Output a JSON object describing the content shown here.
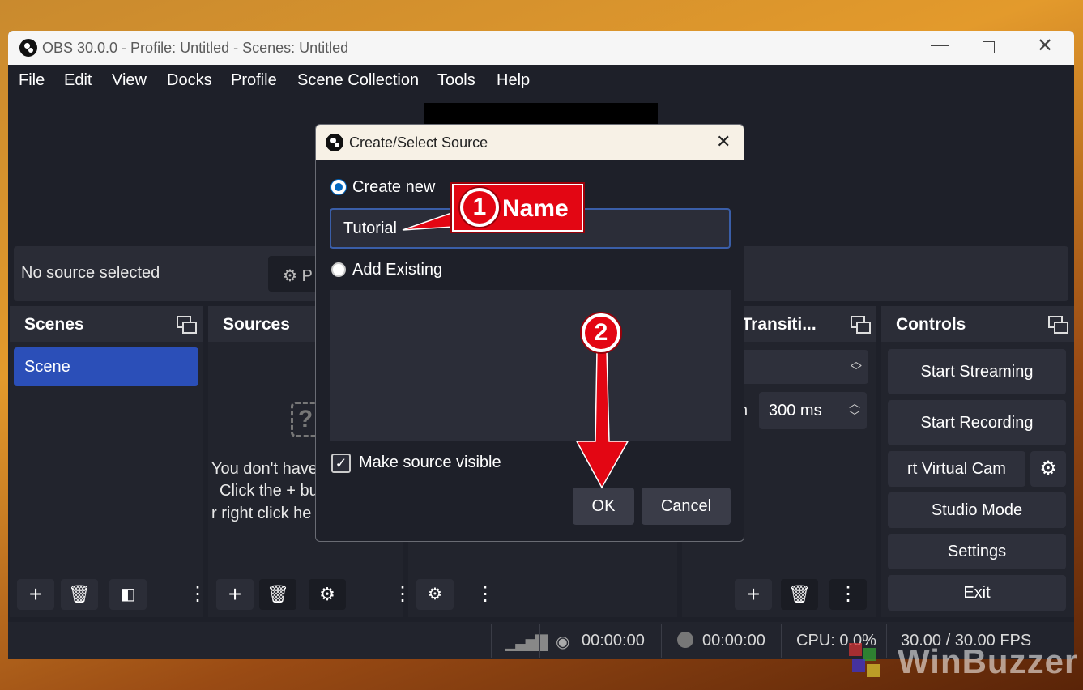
{
  "window": {
    "title": "OBS 30.0.0 - Profile: Untitled - Scenes: Untitled"
  },
  "menu": [
    "File",
    "Edit",
    "View",
    "Docks",
    "Profile",
    "Scene Collection",
    "Tools",
    "Help"
  ],
  "source_bar": {
    "no_source": "No source selected",
    "properties_fragment": "P"
  },
  "scenes": {
    "title": "Scenes",
    "items": [
      "Scene"
    ]
  },
  "sources": {
    "title": "Sources",
    "empty_lines": [
      "You don't have",
      "Click the + bu",
      "r right click he"
    ]
  },
  "transitions": {
    "title": "e Transiti...",
    "duration_label": "n",
    "duration_value": "300 ms"
  },
  "controls": {
    "title": "Controls",
    "start_streaming": "Start Streaming",
    "start_recording": "Start Recording",
    "virtual_cam": "rt Virtual Cam",
    "studio_mode": "Studio Mode",
    "settings": "Settings",
    "exit": "Exit"
  },
  "status": {
    "stream_time": "00:00:00",
    "record_time": "00:00:00",
    "cpu": "CPU: 0.0%",
    "fps": "30.00 / 30.00 FPS"
  },
  "dialog": {
    "title": "Create/Select Source",
    "create_new": "Create new",
    "name_value": "Tutorial",
    "add_existing": "Add Existing",
    "make_visible": "Make source visible",
    "ok": "OK",
    "cancel": "Cancel"
  },
  "annotations": {
    "step1_number": "1",
    "step1_label": "Name",
    "step2_number": "2"
  },
  "watermark": "WinBuzzer",
  "colors": {
    "accent": "#3a5ea8",
    "selected_scene": "#2b4fb8",
    "callout_red": "#e30613"
  }
}
